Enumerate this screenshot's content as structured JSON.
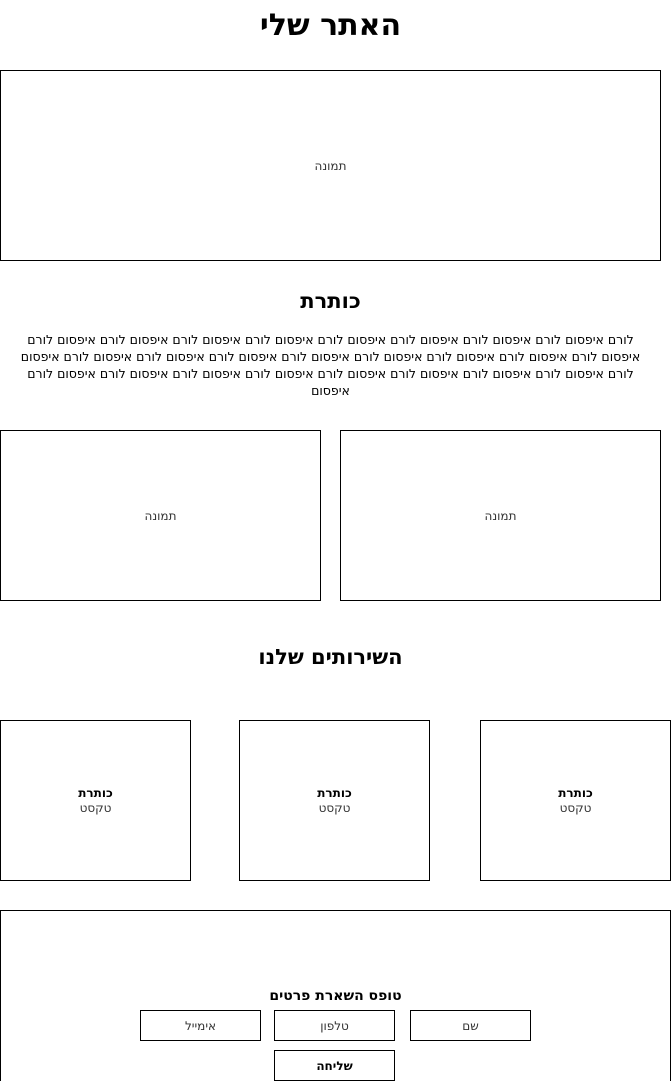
{
  "site": {
    "title": "האתר שלי"
  },
  "hero": {
    "image_label": "תמונה"
  },
  "intro": {
    "heading": "כותרת",
    "body": "לורם איפסום לורם איפסום לורם איפסום לורם איפסום לורם איפסום לורם איפסום לורם איפסום לורם איפסום לורם איפסום לורם איפסום לורם איפסום לורם איפסום לורם איפסום לורם איפסום לורם איפסום לורם איפסום לורם איפסום לורם איפסום לורם איפסום לורם איפסום לורם איפסום לורם איפסום לורם איפסום לורם איפסום לורם איפסום לורם איפסום"
  },
  "gallery": {
    "image_right_label": "תמונה",
    "image_left_label": "תמונה"
  },
  "services": {
    "heading": "השירותים שלנו",
    "items": [
      {
        "title": "כותרת",
        "text": "טקסט"
      },
      {
        "title": "כותרת",
        "text": "טקסט"
      },
      {
        "title": "כותרת",
        "text": "טקסט"
      }
    ]
  },
  "contact_form": {
    "title": "טופס השארת פרטים",
    "name_field": "שם",
    "phone_field": "טלפון",
    "email_field": "אימייל",
    "submit_label": "שליחה"
  }
}
